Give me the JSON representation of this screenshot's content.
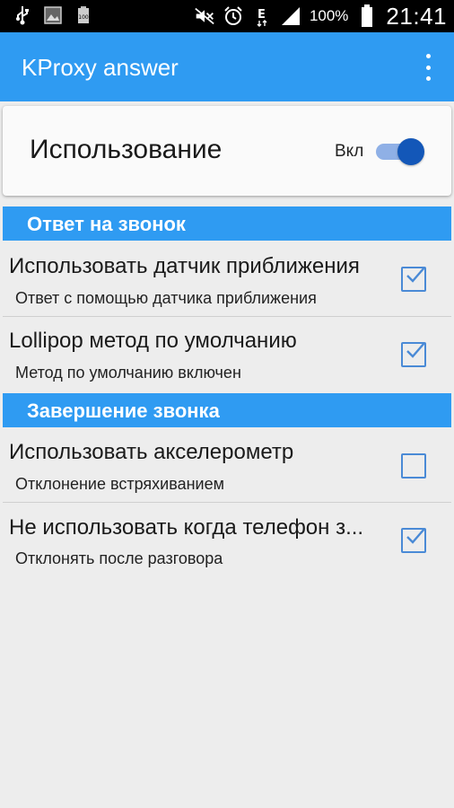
{
  "status_bar": {
    "icons": [
      "usb-icon",
      "image-icon",
      "battery-small-icon",
      "mute-icon",
      "alarm-icon",
      "data-e-icon",
      "signal-icon",
      "battery-icon"
    ],
    "battery_percent": "100%",
    "time": "21:41"
  },
  "app_bar": {
    "title": "KProxy answer",
    "menu_icon": "overflow-menu-icon"
  },
  "master": {
    "title": "Использование",
    "switch_label": "Вкл",
    "switch_on": true
  },
  "sections": [
    {
      "title": "Ответ на звонок",
      "items": [
        {
          "title": "Использовать датчик приближения",
          "subtitle": "Ответ с помощью датчика приближения",
          "checked": true
        },
        {
          "title": "Lollipop метод по умолчанию",
          "subtitle": "Метод по умолчанию включен",
          "checked": true
        }
      ]
    },
    {
      "title": "Завершение звонка",
      "items": [
        {
          "title": "Использовать акселерометр",
          "subtitle": "Отклонение встряхиванием",
          "checked": false
        },
        {
          "title": "Не использовать когда телефон з...",
          "subtitle": "Отклонять после разговора",
          "checked": true
        }
      ]
    }
  ],
  "colors": {
    "accent": "#2f9bf2",
    "switch_thumb": "#1357b8",
    "checkbox": "#4a8ad6",
    "background": "#ededed"
  }
}
